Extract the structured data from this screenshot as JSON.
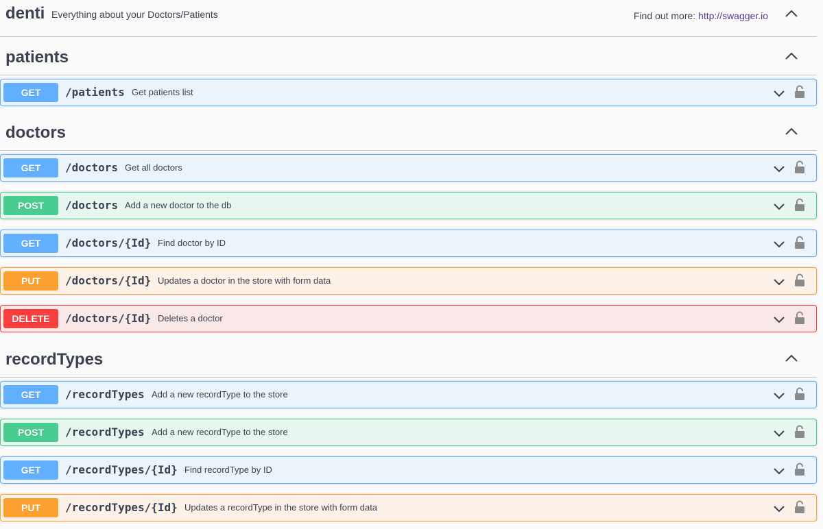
{
  "header": {
    "title": "denti",
    "description": "Everything about your Doctors/Patients",
    "find_more_label": "Find out more:",
    "find_more_link": "http://swagger.io"
  },
  "sections": [
    {
      "name": "patients",
      "operations": [
        {
          "method": "GET",
          "path": "/patients",
          "summary": "Get patients list"
        }
      ]
    },
    {
      "name": "doctors",
      "operations": [
        {
          "method": "GET",
          "path": "/doctors",
          "summary": "Get all doctors"
        },
        {
          "method": "POST",
          "path": "/doctors",
          "summary": "Add a new doctor to the db"
        },
        {
          "method": "GET",
          "path": "/doctors/{Id}",
          "summary": "Find doctor by ID"
        },
        {
          "method": "PUT",
          "path": "/doctors/{Id}",
          "summary": "Updates a doctor in the store with form data"
        },
        {
          "method": "DELETE",
          "path": "/doctors/{Id}",
          "summary": "Deletes a doctor"
        }
      ]
    },
    {
      "name": "recordTypes",
      "operations": [
        {
          "method": "GET",
          "path": "/recordTypes",
          "summary": "Add a new recordType to the store"
        },
        {
          "method": "POST",
          "path": "/recordTypes",
          "summary": "Add a new recordType to the store"
        },
        {
          "method": "GET",
          "path": "/recordTypes/{Id}",
          "summary": "Find recordType by ID"
        },
        {
          "method": "PUT",
          "path": "/recordTypes/{Id}",
          "summary": "Updates a recordType in the store with form data"
        }
      ]
    }
  ],
  "colors": {
    "get": "#61affe",
    "post": "#49cc90",
    "put": "#fca130",
    "delete": "#f93e3e",
    "text": "#3b4151",
    "link": "#5a3b8c"
  },
  "icons": {
    "collapse": "chevron-up-icon",
    "expand": "chevron-down-icon",
    "auth": "unlocked-icon"
  }
}
